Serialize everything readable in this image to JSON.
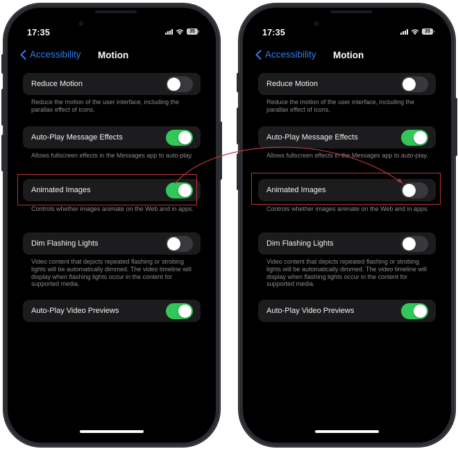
{
  "annotation": {
    "highlight_color": "#b8373d",
    "description": "arrow from ON toggle to OFF toggle for Animated Images"
  },
  "colors": {
    "toggle_on": "#32c759",
    "toggle_off": "#39393d",
    "link_blue": "#2f7cf6",
    "row_bg": "#1c1c1e",
    "footnote": "#8d8d93"
  },
  "phones": [
    {
      "status_bar": {
        "time": "17:35",
        "battery": "35",
        "icons": [
          "signal-icon",
          "wifi-icon",
          "battery-icon"
        ]
      },
      "nav": {
        "back_label": "Accessibility",
        "back_icon": "chevron-left-icon",
        "title": "Motion"
      },
      "settings": [
        {
          "label": "Reduce Motion",
          "on": false,
          "footnote": "Reduce the motion of the user interface, including the parallax effect of icons."
        },
        {
          "label": "Auto-Play Message Effects",
          "on": true,
          "footnote": "Allows fullscreen effects in the Messages app to auto-play."
        },
        {
          "label": "Animated Images",
          "on": true,
          "footnote": "Controls whether images animate on the Web and in apps.",
          "highlighted": true
        },
        {
          "label": "Dim Flashing Lights",
          "on": false,
          "footnote": "Video content that depicts repeated flashing or strobing lights will be automatically dimmed. The video timeline will display when flashing lights occur in the content for supported media."
        },
        {
          "label": "Auto-Play Video Previews",
          "on": true,
          "footnote": ""
        }
      ]
    },
    {
      "status_bar": {
        "time": "17:35",
        "battery": "35",
        "icons": [
          "signal-icon",
          "wifi-icon",
          "battery-icon"
        ]
      },
      "nav": {
        "back_label": "Accessibility",
        "back_icon": "chevron-left-icon",
        "title": "Motion"
      },
      "settings": [
        {
          "label": "Reduce Motion",
          "on": false,
          "footnote": "Reduce the motion of the user interface, including the parallax effect of icons."
        },
        {
          "label": "Auto-Play Message Effects",
          "on": true,
          "footnote": "Allows fullscreen effects in the Messages app to auto-play."
        },
        {
          "label": "Animated Images",
          "on": false,
          "footnote": "Controls whether images animate on the Web and in apps.",
          "highlighted": true
        },
        {
          "label": "Dim Flashing Lights",
          "on": false,
          "footnote": "Video content that depicts repeated flashing or strobing lights will be automatically dimmed. The video timeline will display when flashing lights occur in the content for supported media."
        },
        {
          "label": "Auto-Play Video Previews",
          "on": true,
          "footnote": ""
        }
      ]
    }
  ]
}
